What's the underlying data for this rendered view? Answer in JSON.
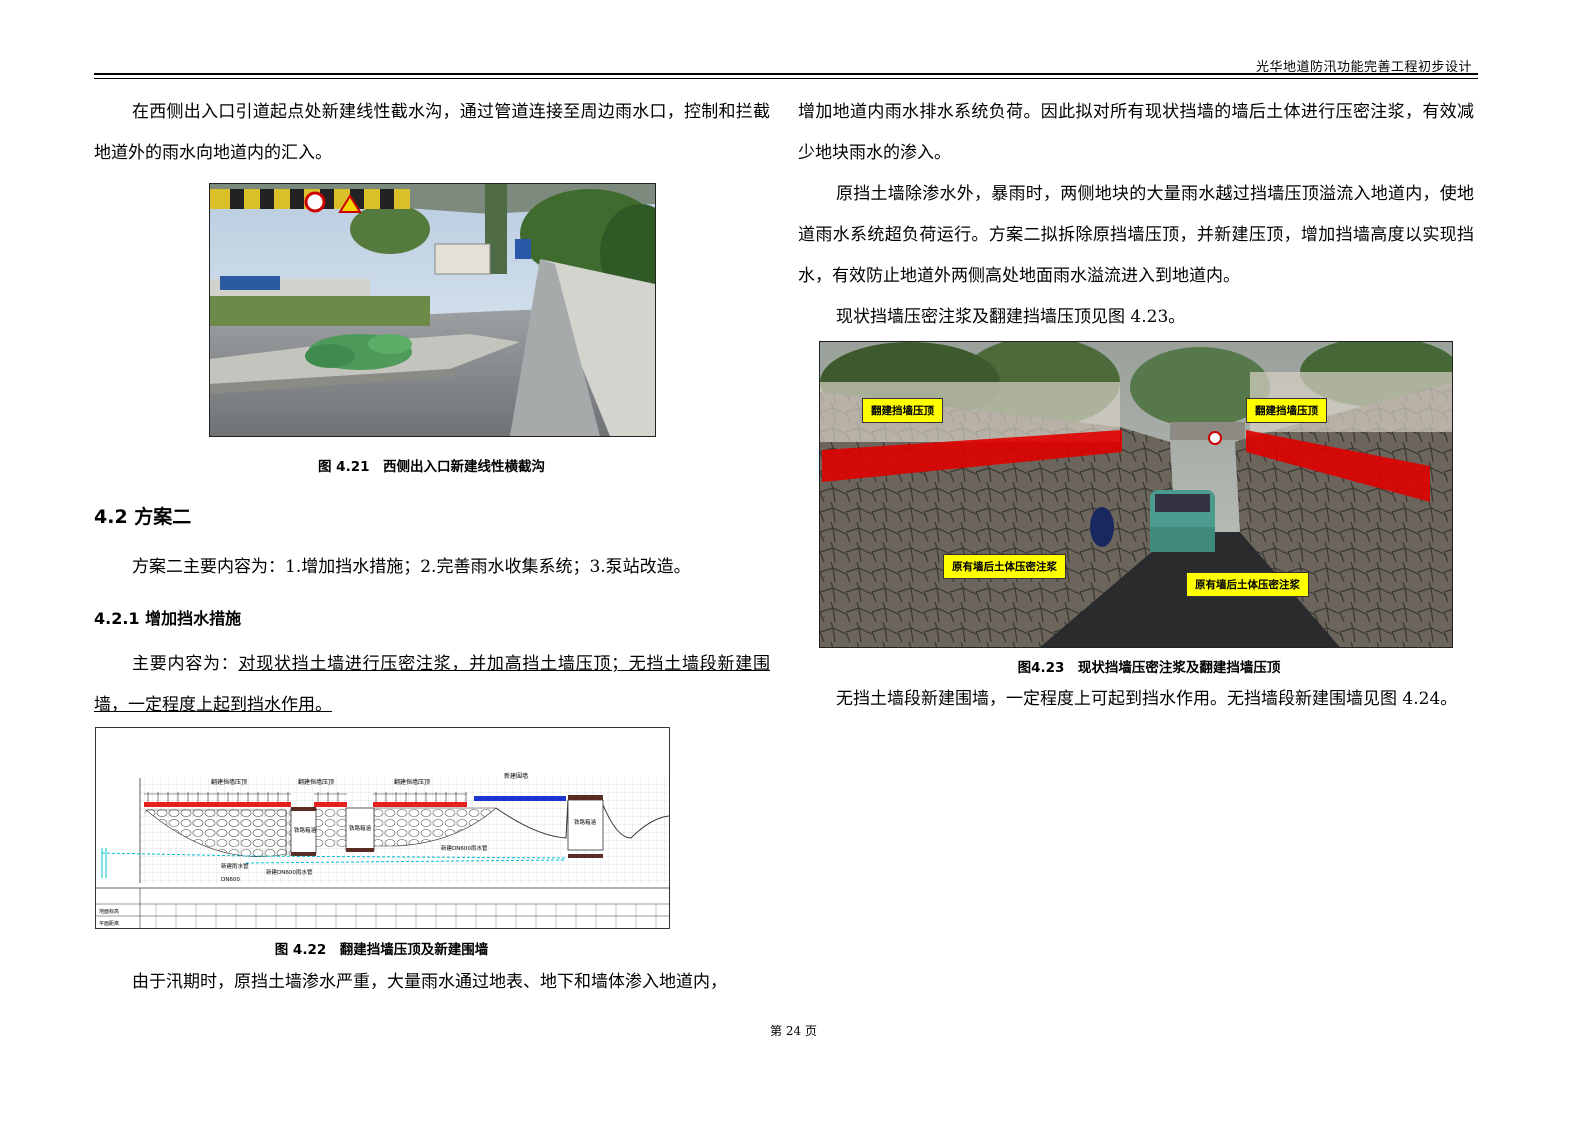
{
  "header": {
    "title": "光华地道防汛功能完善工程初步设计"
  },
  "left": {
    "para1": "在西侧出入口引道起点处新建线性截水沟，通过管道连接至周边雨水口，控制和拦截地道外的雨水向地道内的汇入。",
    "fig21_caption": "图 4.21　西侧出入口新建线性横截沟",
    "h2": "4.2  方案二",
    "para2": "方案二主要内容为：1.增加挡水措施；2.完善雨水收集系统；3.泵站改造。",
    "h3": "4.2.1  增加挡水措施",
    "para3_prefix": "主要内容为：",
    "para3_underlined": "对现状挡土墙进行压密注浆，并加高挡土墙压顶；无挡土墙段新建围墙，一定程度上起到挡水作用。",
    "fig22_caption": "图 4.22　翻建挡墙压顶及新建围墙",
    "para4": "由于汛期时，原挡土墙渗水严重，大量雨水通过地表、地下和墙体渗入地道内，"
  },
  "right": {
    "para1": "增加地道内雨水排水系统负荷。因此拟对所有现状挡墙的墙后土体进行压密注浆，有效减少地块雨水的渗入。",
    "para2": "原挡土墙除渗水外，暴雨时，两侧地块的大量雨水越过挡墙压顶溢流入地道内，使地道雨水系统超负荷运行。方案二拟拆除原挡墙压顶，并新建压顶，增加挡墙高度以实现挡水，有效防止地道外两侧高处地面雨水溢流进入到地道内。",
    "para3": "现状挡墙压密注浆及翻建挡墙压顶见图 4.23。",
    "fig23_caption": "图4.23　现状挡墙压密注浆及翻建挡墙压顶",
    "fig23_labels": [
      "翻建挡墙压顶",
      "翻建挡墙压顶",
      "原有墙后土体压密注浆",
      "原有墙后土体压密注浆"
    ],
    "para4": "无挡土墙段新建围墙，一定程度上可起到挡水作用。无挡墙段新建围墙见图 4.24。"
  },
  "fig22_labels": {
    "top": [
      "翻建挡墙压顶",
      "翻建挡墙压顶",
      "翻建挡墙压顶",
      "新建围墙"
    ],
    "mid": [
      "铁路箱涵",
      "铁路箱涵",
      "铁路箱涵"
    ],
    "pipe1": "新建DN600雨水管",
    "pipe2": "新建DN600雨水管",
    "pipe3": "新建雨水管",
    "pipe3b": "DN600",
    "row1": "地面标高",
    "row2": "平面距离"
  },
  "footer": {
    "page": "第 24 页"
  }
}
